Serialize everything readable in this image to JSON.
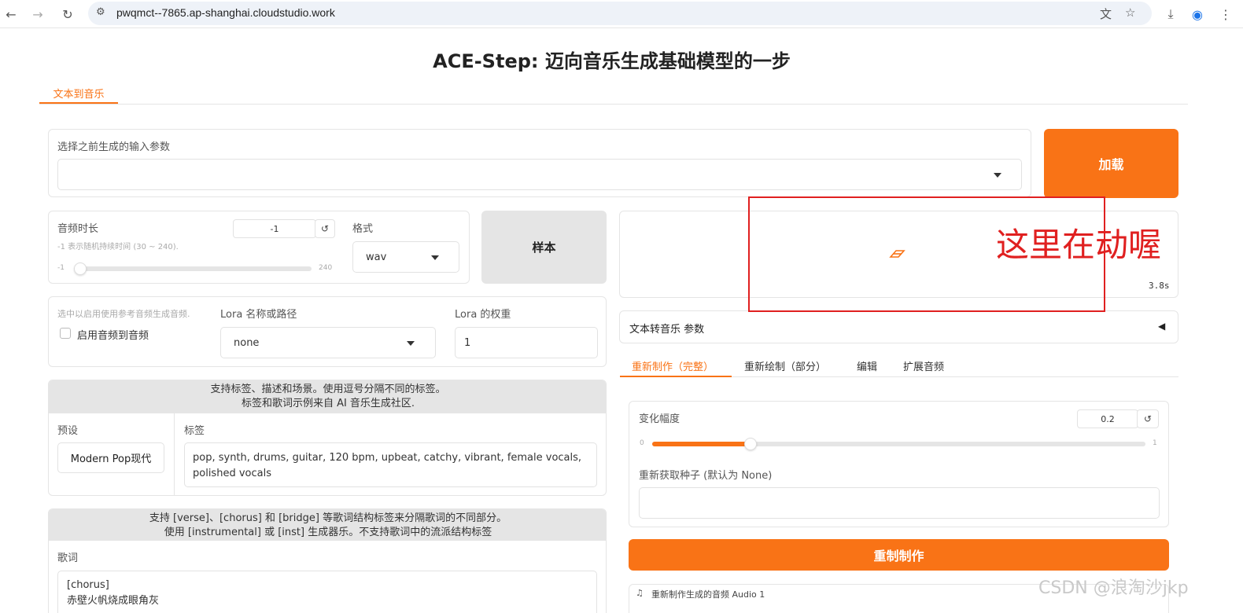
{
  "browser": {
    "url": "pwqmct--7865.ap-shanghai.cloudstudio.work"
  },
  "page": {
    "title": "ACE-Step: 迈向音乐生成基础模型的一步",
    "tabs": [
      {
        "label": "文本到音乐"
      }
    ]
  },
  "history": {
    "label": "选择之前生成的输入参数",
    "value": "",
    "load_label": "加载"
  },
  "duration": {
    "label": "音频时长",
    "hint": "-1 表示随机持续时间 (30 ~ 240).",
    "value": "-1",
    "min": "-1",
    "max": "240",
    "reset_icon": "↺"
  },
  "format": {
    "label": "格式",
    "value": "wav"
  },
  "sample_label": "样本",
  "audio2audio": {
    "hint": "选中以启用使用参考音频生成音频.",
    "checkbox_label": "启用音频到音频",
    "checked": false
  },
  "lora": {
    "name_label": "Lora 名称或路径",
    "name_value": "none",
    "weight_label": "Lora 的权重",
    "weight_value": "1"
  },
  "tags_section": {
    "header_line1": "支持标签、描述和场景。使用逗号分隔不同的标签。",
    "header_line2": "标签和歌词示例来自 AI 音乐生成社区.",
    "preset_label": "预设",
    "preset_value": "Modern Pop现代",
    "tags_label": "标签",
    "tags_value": "pop, synth, drums, guitar, 120 bpm, upbeat, catchy, vibrant, female vocals, polished vocals"
  },
  "lyrics_section": {
    "header_line1": "支持 [verse]、[chorus] 和 [bridge] 等歌词结构标签来分隔歌词的不同部分。",
    "header_line2": "使用 [instrumental] 或 [inst] 生成器乐。不支持歌词中的流派结构标签",
    "lyrics_label": "歌词",
    "lyrics_line1": "[chorus]",
    "lyrics_line2": "赤壁火帆烧成眼角灰"
  },
  "output": {
    "timer": "3.8s",
    "params_label": "文本转音乐 参数",
    "collapse_icon": "◀"
  },
  "sub_tabs": [
    {
      "label": "重新制作（完整）",
      "active": true
    },
    {
      "label": "重新绘制（部分）",
      "active": false
    },
    {
      "label": "编辑",
      "active": false
    },
    {
      "label": "扩展音频",
      "active": false
    }
  ],
  "retake": {
    "variance_label": "变化幅度",
    "variance_value": "0.2",
    "variance_fraction": 0.2,
    "min": "0",
    "max": "1",
    "seed_label": "重新获取种子 (默认为 None)",
    "seed_value": "",
    "button_label": "重制制作",
    "audio_label": "重新制作生成的音频 Audio 1"
  },
  "annotation": {
    "text": "这里在动喔"
  },
  "watermark": "CSDN @浪淘沙jkp",
  "colors": {
    "accent": "#f97316",
    "annotation": "#e02020",
    "panel_gray": "#e5e5e5"
  }
}
